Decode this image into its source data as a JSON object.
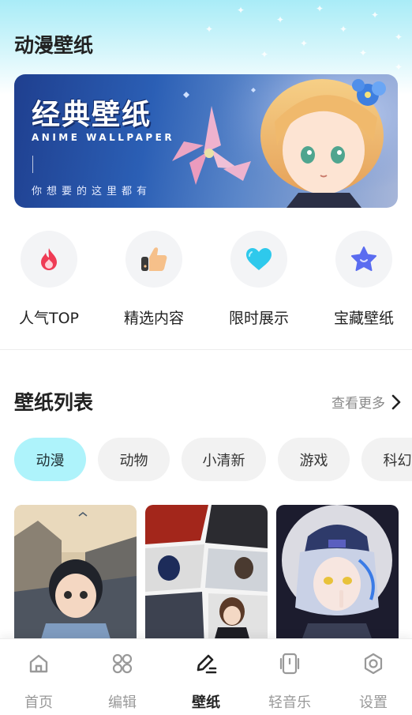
{
  "header": {
    "title": "动漫壁纸"
  },
  "banner": {
    "title": "经典壁纸",
    "subtitle": "ANIME WALLPAPER",
    "slogan": "你想要的这里都有"
  },
  "quick_links": [
    {
      "label": "人气TOP",
      "icon": "fire-icon",
      "color": "#ef3b55"
    },
    {
      "label": "精选内容",
      "icon": "thumbs-up-icon",
      "color": "#f6c08a"
    },
    {
      "label": "限时展示",
      "icon": "heart-icon",
      "color": "#2ec9ec"
    },
    {
      "label": "宝藏壁纸",
      "icon": "star-icon",
      "color": "#5a6cf0"
    }
  ],
  "wallpaper_list": {
    "title": "壁纸列表",
    "more_label": "查看更多",
    "tabs": [
      {
        "label": "动漫",
        "active": true
      },
      {
        "label": "动物",
        "active": false
      },
      {
        "label": "小清新",
        "active": false
      },
      {
        "label": "游戏",
        "active": false
      },
      {
        "label": "科幻",
        "active": false
      }
    ]
  },
  "bottom_nav": [
    {
      "label": "首页",
      "icon": "home-icon",
      "active": false
    },
    {
      "label": "编辑",
      "icon": "grid-icon",
      "active": false
    },
    {
      "label": "壁纸",
      "icon": "pen-icon",
      "active": true
    },
    {
      "label": "轻音乐",
      "icon": "music-icon",
      "active": false
    },
    {
      "label": "设置",
      "icon": "settings-icon",
      "active": false
    }
  ],
  "colors": {
    "accent": "#aef3fb",
    "text": "#222222",
    "muted": "#999999"
  }
}
